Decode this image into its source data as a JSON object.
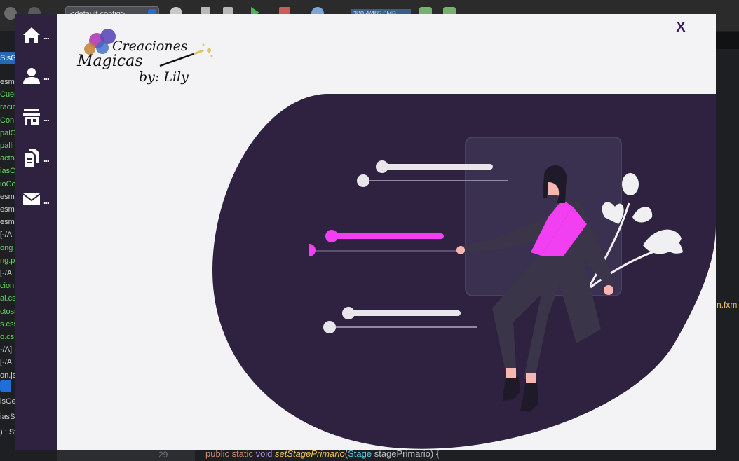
{
  "ide": {
    "config_select": "<default config>",
    "memory_readout": "380.4/485.0MB",
    "left_tab": "SisGe",
    "tree_items": [
      {
        "text": "esm",
        "color": "#cfcfcf"
      },
      {
        "text": "Cuen",
        "color": "#5fd35f"
      },
      {
        "text": "racio",
        "color": "#5fd35f"
      },
      {
        "text": "Con",
        "color": "#5fd35f"
      },
      {
        "text": "palC",
        "color": "#5fd35f"
      },
      {
        "text": "palli",
        "color": "#5fd35f"
      },
      {
        "text": "actos",
        "color": "#5fd35f"
      },
      {
        "text": "iasC",
        "color": "#5fd35f"
      },
      {
        "text": "ioCo",
        "color": "#5fd35f"
      },
      {
        "text": "esm",
        "color": "#cfcfcf"
      },
      {
        "text": "esm",
        "color": "#cfcfcf"
      },
      {
        "text": "esm",
        "color": "#cfcfcf"
      },
      {
        "text": "[-/A",
        "color": "#cfcfcf"
      },
      {
        "text": "ong",
        "color": "#5fd35f"
      },
      {
        "text": "ng.p",
        "color": "#5fd35f"
      },
      {
        "text": " [-/A",
        "color": "#cfcfcf"
      },
      {
        "text": "cion",
        "color": "#5fd35f"
      },
      {
        "text": "al.cs",
        "color": "#5fd35f"
      },
      {
        "text": "ctoss",
        "color": "#5fd35f"
      },
      {
        "text": "s.css",
        "color": "#5fd35f"
      },
      {
        "text": "o.css",
        "color": "#5fd35f"
      },
      {
        "text": "-/A]",
        "color": "#cfcfcf"
      },
      {
        "text": "[-/A",
        "color": "#cfcfcf"
      },
      {
        "text": "on.ja",
        "color": "#cfcfcf"
      }
    ],
    "lower_items": [
      "isGe",
      "iasSi",
      ") : Stag"
    ],
    "right_fxml": "n.fxm",
    "line_number": "29",
    "code": {
      "kw1": "public",
      "kw2": "static",
      "kw3": "void",
      "method": "setStagePrimario",
      "open": "(",
      "type": "Stage",
      "rest": " stagePrimario) {"
    }
  },
  "app": {
    "sidebar_items": [
      {
        "name": "home",
        "icon": "home-icon",
        "more": "..."
      },
      {
        "name": "user",
        "icon": "user-icon",
        "more": "..."
      },
      {
        "name": "store",
        "icon": "store-icon",
        "more": "..."
      },
      {
        "name": "documents",
        "icon": "documents-icon",
        "more": "..."
      },
      {
        "name": "mail",
        "icon": "mail-icon",
        "more": "..."
      }
    ],
    "close_label": "X",
    "logo": {
      "line1": "Creaciones",
      "line2": "Magicas",
      "line3": "by: Lily"
    }
  },
  "colors": {
    "sidebar_bg": "#2e2240",
    "main_bg": "#f3f3f5",
    "blob": "#2e2240",
    "accent_pink": "#f13ff1",
    "close": "#3b1a63"
  }
}
